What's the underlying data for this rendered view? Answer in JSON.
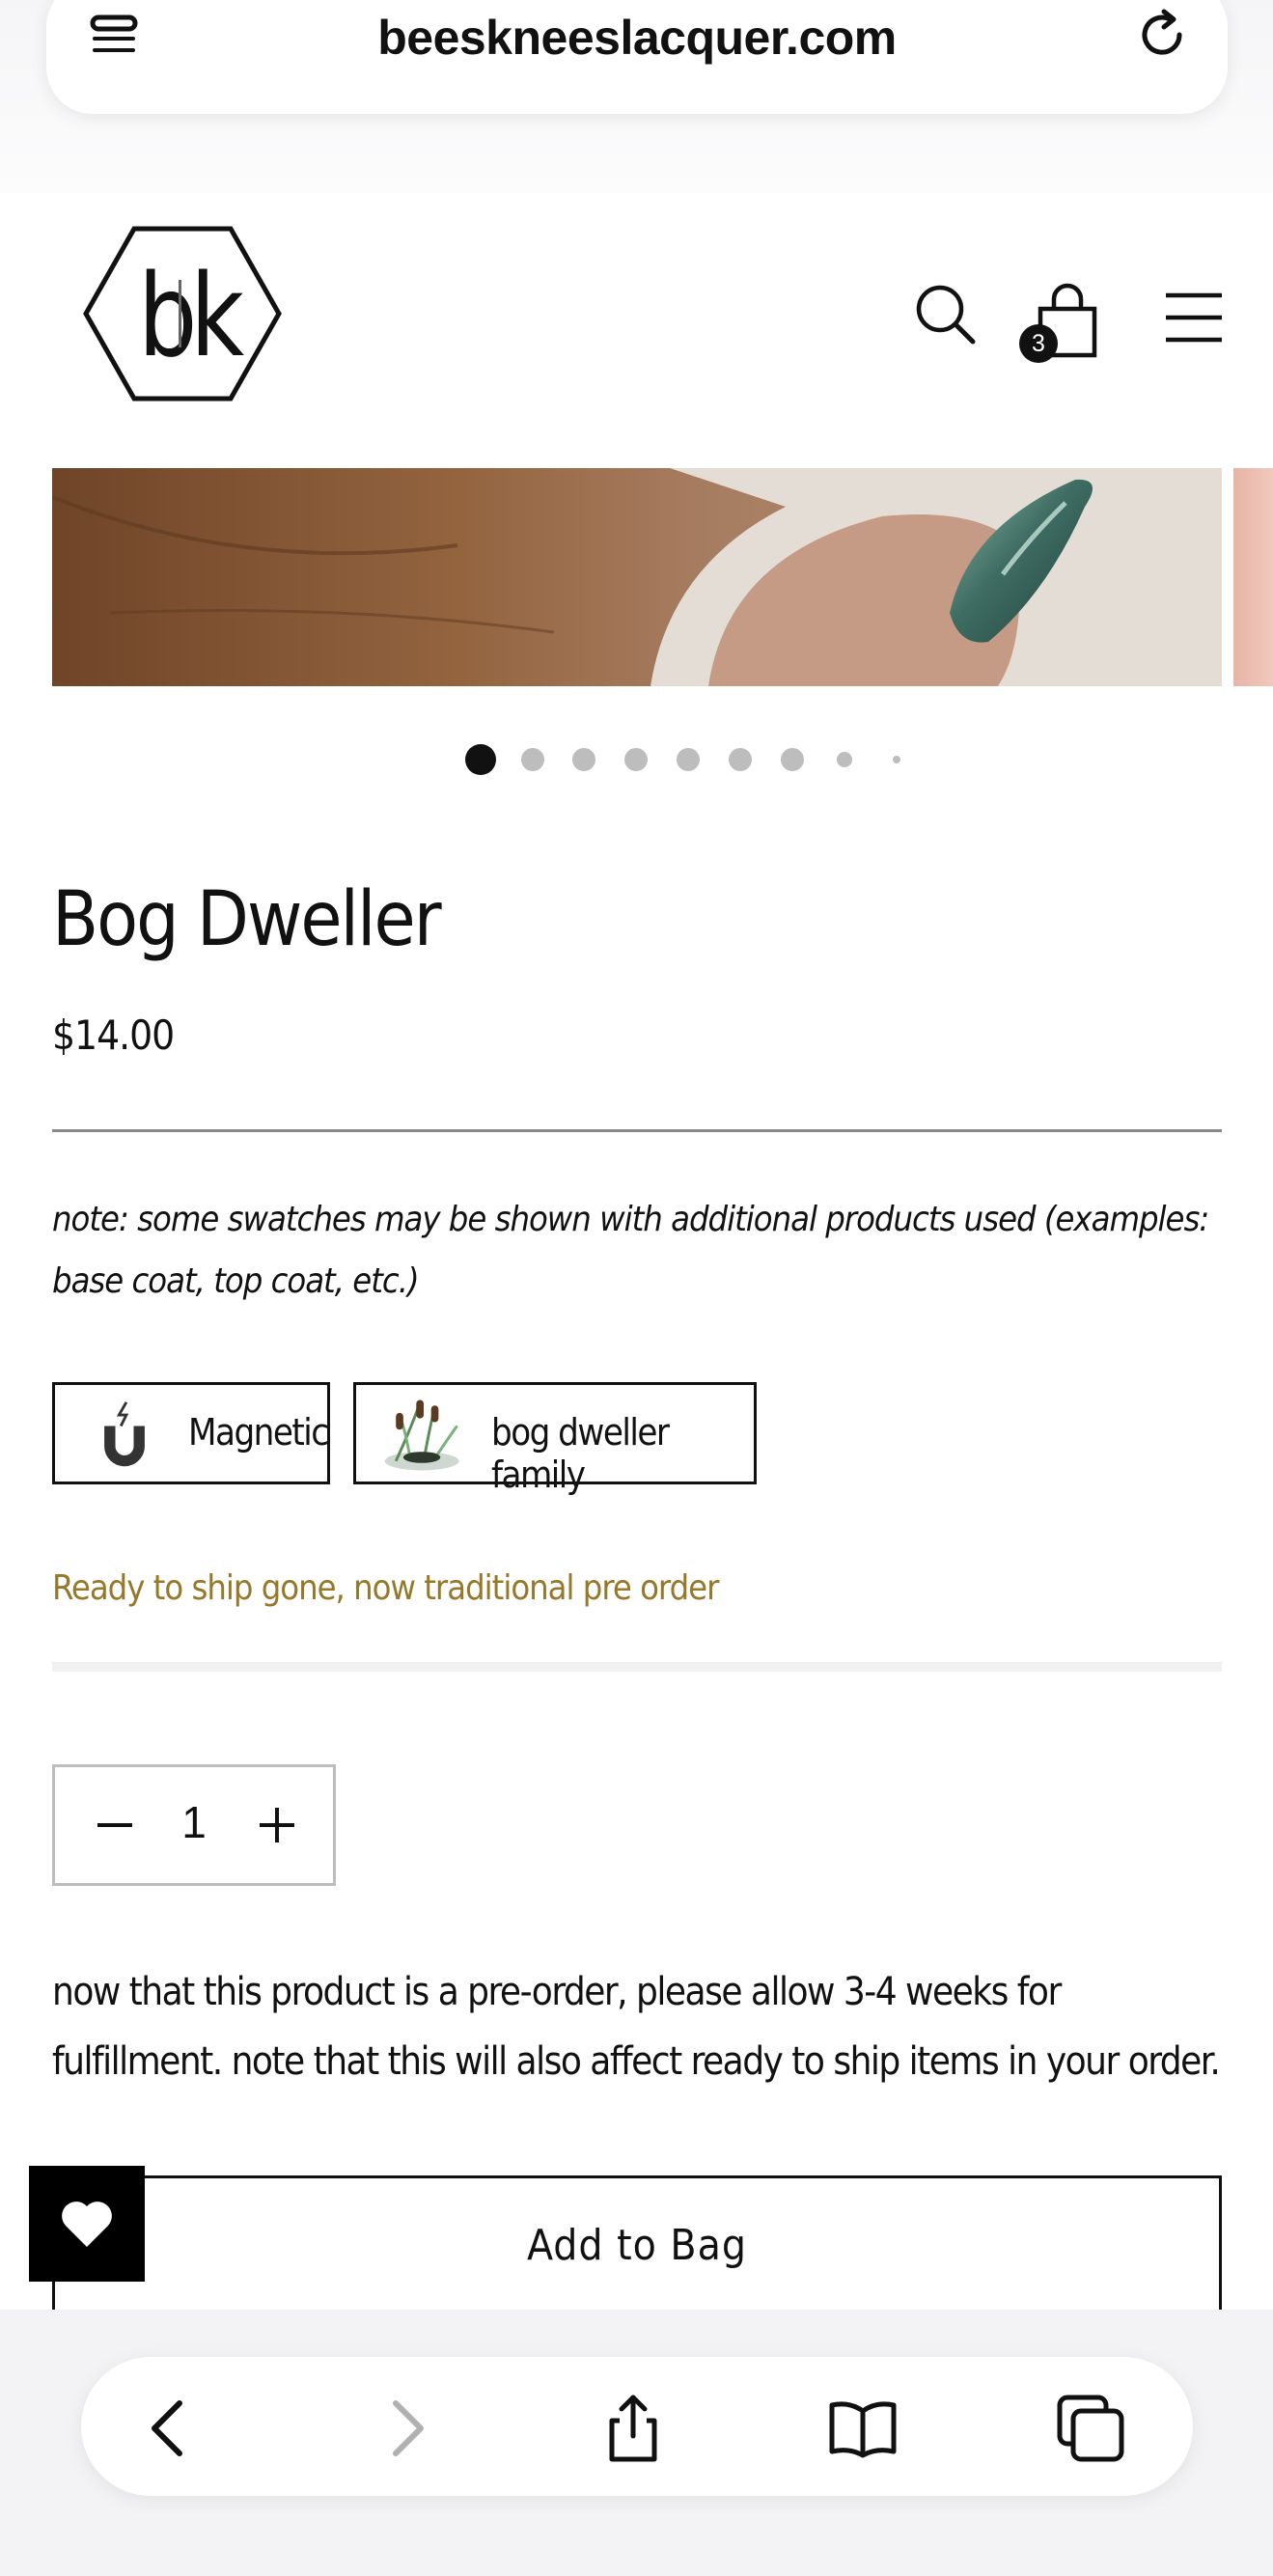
{
  "browser": {
    "url": "beeskneeslacquer.com"
  },
  "header": {
    "logo_text": "b|k",
    "cart_count": "3"
  },
  "gallery": {
    "total_images": 9,
    "current_index": 0
  },
  "product": {
    "title": "Bog Dweller",
    "price": "$14.00",
    "note": "note: some swatches may be shown with additional products used (examples: base coat, top coat, etc.)",
    "variants": [
      {
        "label": "Magnetic",
        "icon": "magnet-icon"
      },
      {
        "label": "bog dweller family",
        "icon": "cattail-marsh-icon"
      }
    ],
    "status": "Ready to ship gone, now traditional pre order",
    "quantity": "1",
    "preorder_info": "now that this product is a pre-order, please allow 3-4 weeks for fulfillment. note that this will also affect ready to ship items in your order.",
    "add_to_bag_label": "Add to Bag"
  },
  "colors": {
    "status_text": "#96782a",
    "wishlist_bg": "#000000"
  },
  "toolbar": {
    "items": [
      "back-icon",
      "forward-icon",
      "share-icon",
      "bookmarks-icon",
      "tabs-icon"
    ]
  }
}
